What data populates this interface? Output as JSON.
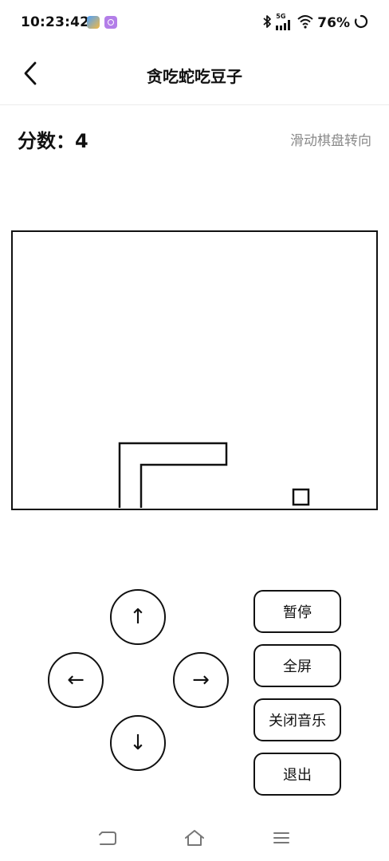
{
  "status_bar": {
    "time": "10:23:42",
    "network_label": "5G",
    "battery": "76%",
    "icons": [
      "bluetooth-icon",
      "signal-icon",
      "wifi-icon",
      "loading-icon"
    ]
  },
  "header": {
    "title": "贪吃蛇吃豆子",
    "back_icon": "chevron-left-icon"
  },
  "game": {
    "score_label": "分数：",
    "score_value": "4",
    "hint": "滑动棋盘转向",
    "snake_direction": "right",
    "snake_length": 4,
    "food_present": true
  },
  "controls": {
    "up": "↑",
    "left": "←",
    "right": "→",
    "down": "↓",
    "pause": "暂停",
    "fullscreen": "全屏",
    "music_off": "关闭音乐",
    "exit": "退出"
  },
  "navbar": {
    "icons": [
      "nav-back-icon",
      "nav-home-icon",
      "nav-menu-icon"
    ]
  },
  "colors": {
    "ink": "#111111",
    "hint_gray": "#8a8a8a",
    "background": "#ffffff",
    "app_icon_purple": "#b37ee8"
  }
}
